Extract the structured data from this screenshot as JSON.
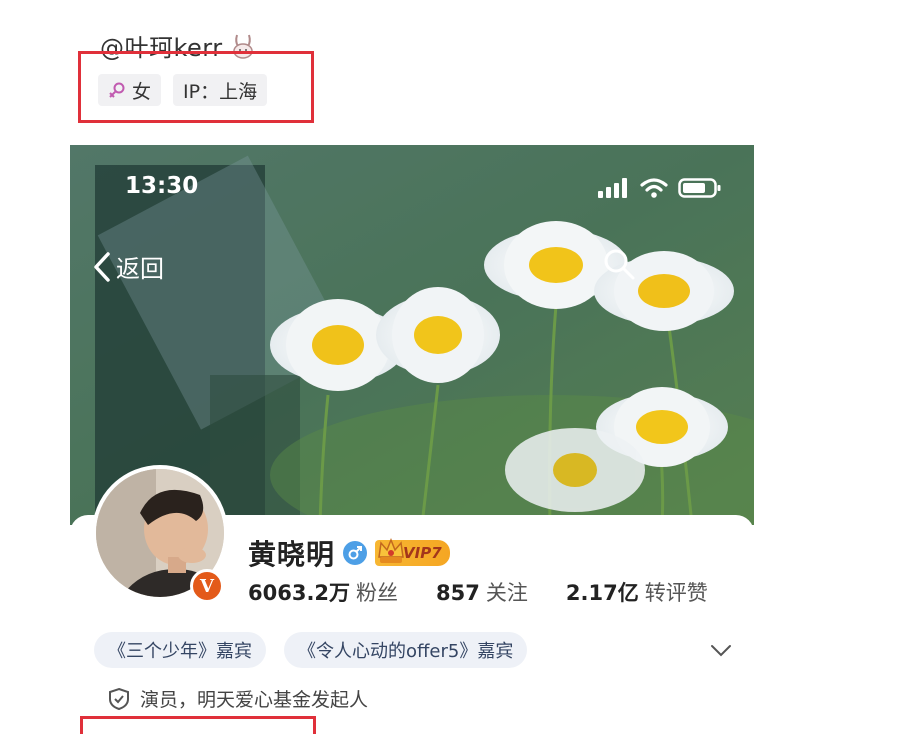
{
  "top": {
    "username": "@叶珂kerr",
    "gender_tag": "女",
    "ip_tag": "IP：上海"
  },
  "phone": {
    "status_time": "13:30",
    "back_label": "返回",
    "profile": {
      "name": "黄晓明",
      "vip_label": "VIP7",
      "fans_count": "6063.2万",
      "fans_label": "粉丝",
      "following_count": "857",
      "following_label": "关注",
      "engagement_count": "2.17亿",
      "engagement_label": "转评赞",
      "tags": [
        "《三个少年》嘉宾",
        "《令人心动的offer5》嘉宾"
      ],
      "bio": "演员，明天爱心基金发起人",
      "verified_badge": "V"
    }
  },
  "colors": {
    "highlight_box": "#e0303a",
    "verified_badge": "#e35a1a",
    "chip_bg": "#eef1f7",
    "vip_gold": "#f5a623"
  },
  "icons": [
    "bunny-icon",
    "female-icon",
    "signal-icon",
    "wifi-icon",
    "battery-icon",
    "back-chevron-icon",
    "search-icon",
    "male-gender-icon",
    "crown-icon",
    "chevron-down-icon",
    "shield-icon"
  ]
}
